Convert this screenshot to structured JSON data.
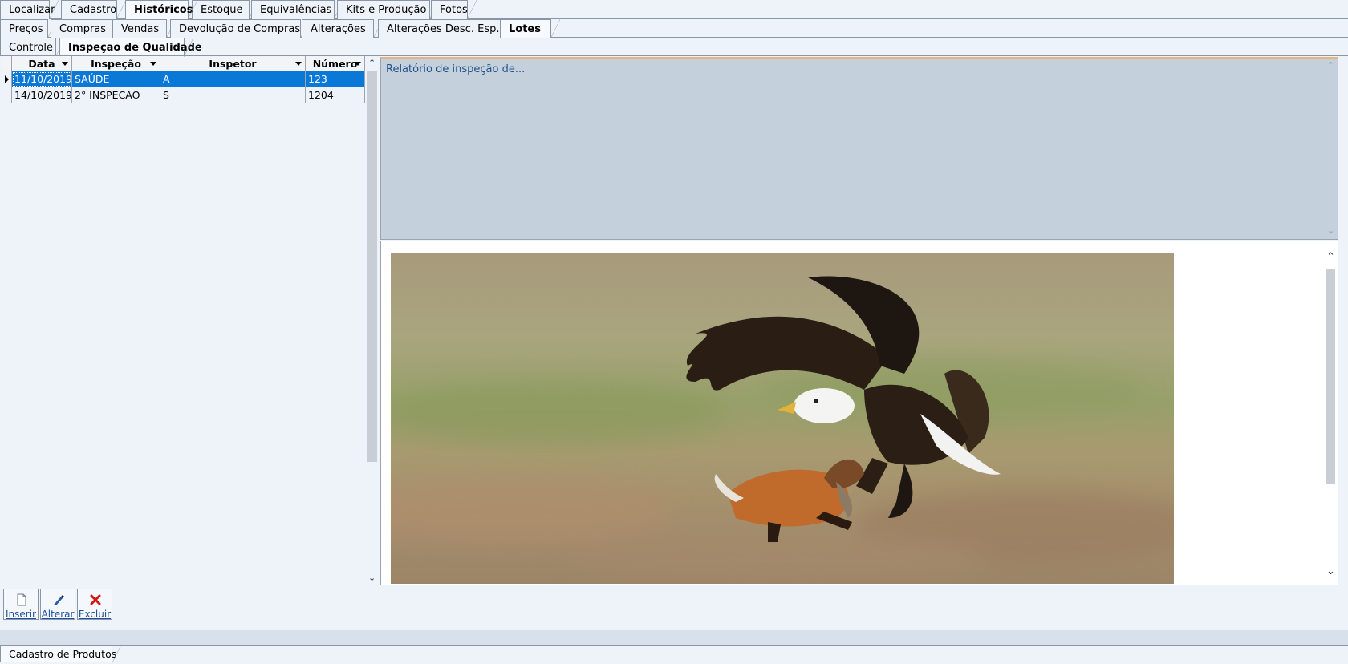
{
  "tabs_main": [
    {
      "label": "Localizar"
    },
    {
      "label": "Cadastro"
    },
    {
      "label": "Históricos",
      "active": true
    },
    {
      "label": "Estoque"
    },
    {
      "label": "Equivalências"
    },
    {
      "label": "Kits e Produção"
    },
    {
      "label": "Fotos"
    }
  ],
  "tabs_hist": [
    {
      "label": "Preços"
    },
    {
      "label": "Compras"
    },
    {
      "label": "Vendas"
    },
    {
      "label": "Devolução de Compras"
    },
    {
      "label": "Alterações"
    },
    {
      "label": "Alterações Desc. Esp."
    },
    {
      "label": "Lotes",
      "active": true
    }
  ],
  "tabs_lotes": [
    {
      "label": "Controle"
    },
    {
      "label": "Inspeção de Qualidade",
      "active": true
    }
  ],
  "grid": {
    "columns": [
      "Data",
      "Inspeção",
      "Inspetor",
      "Número"
    ],
    "rows": [
      {
        "data": "11/10/2019",
        "inspecao": "SAÚDE",
        "inspetor": "A",
        "numero": "123"
      },
      {
        "data": "14/10/2019",
        "inspecao": "2° INSPECAO",
        "inspetor": "S",
        "numero": "1204"
      }
    ]
  },
  "memo": {
    "text": "Relatório de inspeção de..."
  },
  "buttons": {
    "inserir": "Inserir",
    "alterar": "Alterar",
    "excluir": "Excluir"
  },
  "bottom_tab": {
    "label": "Cadastro de Produtos"
  },
  "icons": {
    "photo": "eagle-fox-photo",
    "inserir": "document-icon",
    "alterar": "pen-icon",
    "excluir": "red-x-icon"
  },
  "colors": {
    "selection": "#0a78d7",
    "memo_bg": "#c4d0dc",
    "memo_top_border": "#e9b27c"
  }
}
